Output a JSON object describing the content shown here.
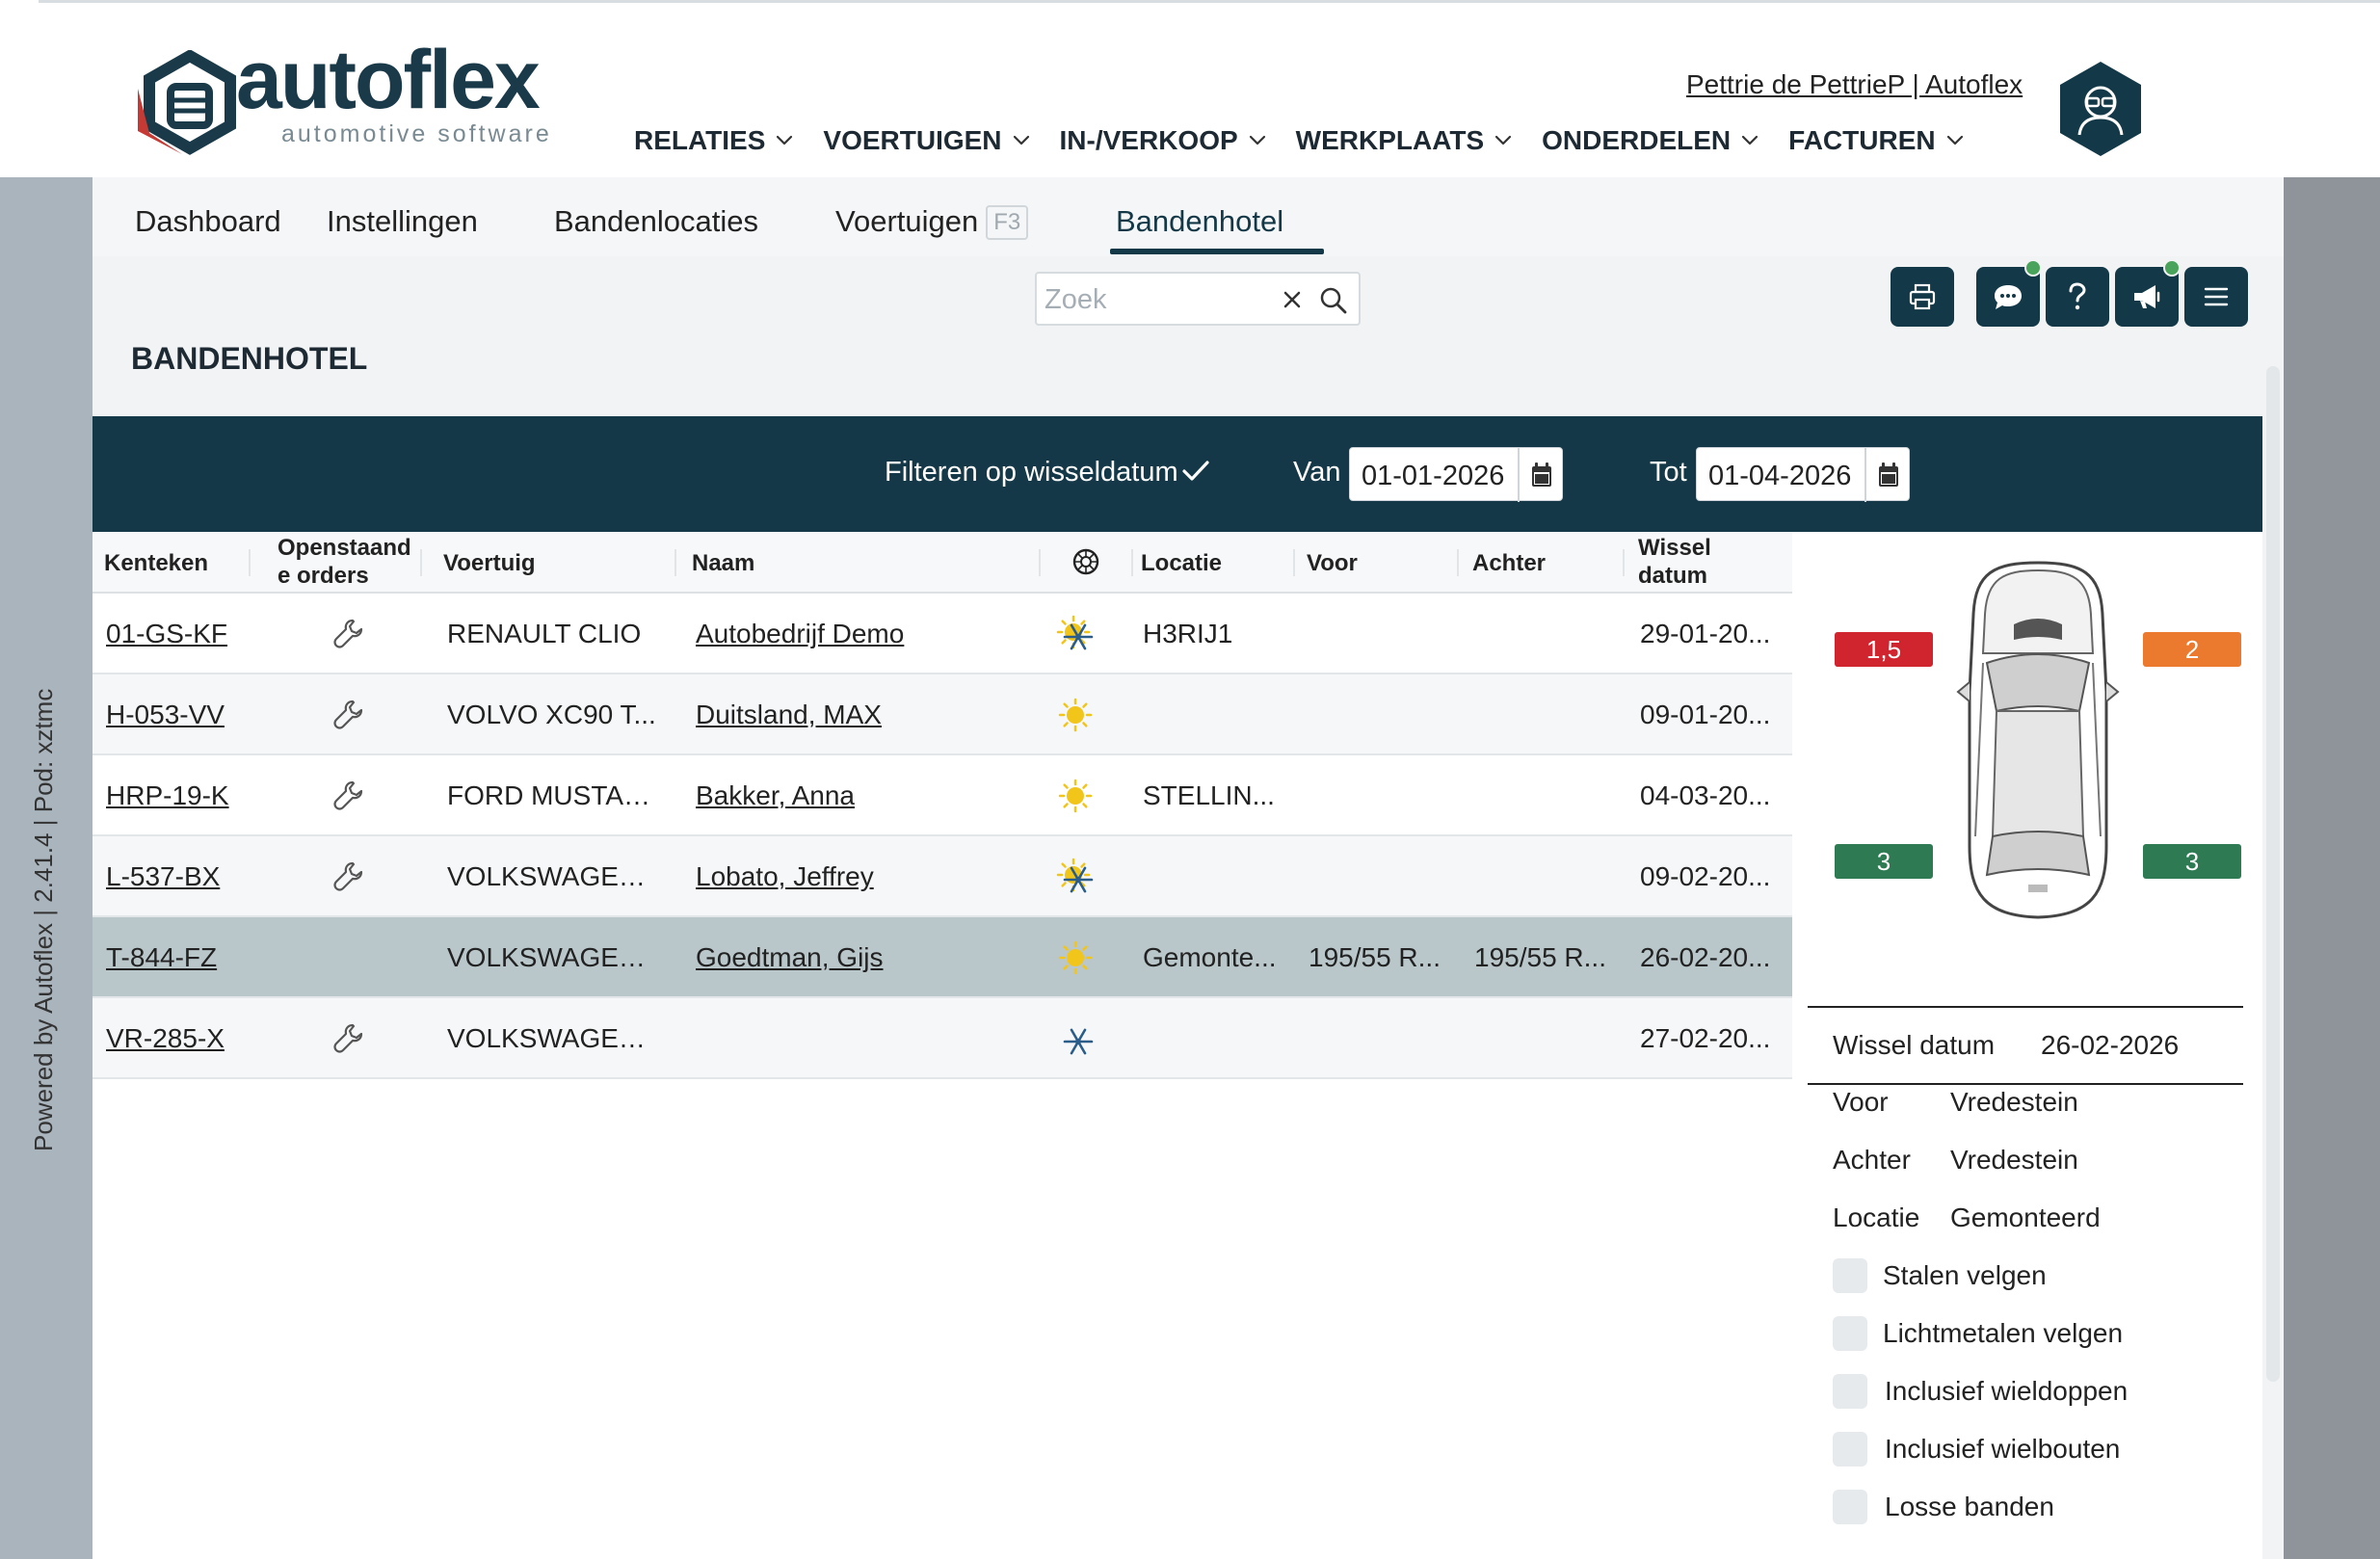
{
  "app": {
    "logo_text": "autoflex",
    "logo_sub": "automotive software",
    "user_link": "Pettrie de PettrieP | Autoflex",
    "powered_by": "Powered by Autoflex | 2.41.4 | Pod: xztmc",
    "brand_color": "#133847"
  },
  "main_nav": [
    "RELATIES",
    "VOERTUIGEN",
    "IN-/VERKOOP",
    "WERKPLAATS",
    "ONDERDELEN",
    "FACTUREN"
  ],
  "sub_nav": {
    "dashboard": "Dashboard",
    "instellingen": "Instellingen",
    "bandenlocaties": "Bandenlocaties",
    "voertuigen": "Voertuigen",
    "voertuigen_shortcut": "F3",
    "bandenhotel": "Bandenhotel",
    "active": "Bandenhotel"
  },
  "search": {
    "placeholder": "Zoek",
    "value": ""
  },
  "toolbar": [
    "printer-icon",
    "chat-icon",
    "help-icon",
    "megaphone-icon",
    "menu-icon"
  ],
  "page_title": "BANDENHOTEL",
  "filter": {
    "label": "Filteren op wisseldatum",
    "checked": true,
    "van_label": "Van",
    "van": "01-01-2026",
    "tot_label": "Tot",
    "tot": "01-04-2026"
  },
  "table": {
    "headers": {
      "kenteken": "Kenteken",
      "openstaand_1": "Openstaand",
      "openstaand_2": "e orders",
      "voertuig": "Voertuig",
      "naam": "Naam",
      "season_icon": "tire-icon",
      "locatie": "Locatie",
      "voor": "Voor",
      "achter": "Achter",
      "wissel_1": "Wissel",
      "wissel_2": "datum"
    },
    "rows": [
      {
        "kenteken": "01-GS-KF",
        "order": true,
        "voertuig": "RENAULT CLIO",
        "naam": "Autobedrijf Demo",
        "season": "all-season",
        "locatie": "H3RIJ1",
        "voor": "",
        "achter": "",
        "wissel": "29-01-20..."
      },
      {
        "kenteken": "H-053-VV",
        "order": true,
        "voertuig": "VOLVO XC90 T...",
        "naam": "Duitsland, MAX",
        "season": "summer",
        "locatie": "",
        "voor": "",
        "achter": "",
        "wissel": "09-01-20..."
      },
      {
        "kenteken": "HRP-19-K",
        "order": true,
        "voertuig": "FORD MUSTAN...",
        "naam": "Bakker, Anna",
        "season": "summer",
        "locatie": "STELLIN...",
        "voor": "",
        "achter": "",
        "wissel": "04-03-20..."
      },
      {
        "kenteken": "L-537-BX",
        "order": true,
        "voertuig": "VOLKSWAGEN ...",
        "naam": "Lobato, Jeffrey",
        "season": "all-season",
        "locatie": "",
        "voor": "",
        "achter": "",
        "wissel": "09-02-20..."
      },
      {
        "kenteken": "T-844-FZ",
        "order": false,
        "voertuig": "VOLKSWAGEN ...",
        "naam": "Goedtman, Gijs",
        "season": "summer",
        "locatie": "Gemonte...",
        "voor": "195/55 R...",
        "achter": "195/55 R...",
        "wissel": "26-02-20...",
        "selected": true
      },
      {
        "kenteken": "VR-285-X",
        "order": true,
        "voertuig": "VOLKSWAGEN ...",
        "naam": "",
        "season": "winter",
        "locatie": "",
        "voor": "",
        "achter": "",
        "wissel": "27-02-20..."
      }
    ]
  },
  "detail": {
    "tread": {
      "left_front": "1,5",
      "right_front": "2",
      "left_rear": "3",
      "right_rear": "3"
    },
    "tread_colors": {
      "red": "#d0242f",
      "orange": "#ec7a2e",
      "green": "#2e7a53"
    },
    "wissel_label": "Wissel datum",
    "wissel_value": "26-02-2026",
    "voor_label": "Voor",
    "voor_value": "Vredestein",
    "achter_label": "Achter",
    "achter_value": "Vredestein",
    "locatie_label": "Locatie",
    "locatie_value": "Gemonteerd",
    "checkboxes": [
      "Stalen velgen",
      "Lichtmetalen velgen",
      "Inclusief wieldoppen",
      "Inclusief wielbouten",
      "Losse banden"
    ]
  }
}
